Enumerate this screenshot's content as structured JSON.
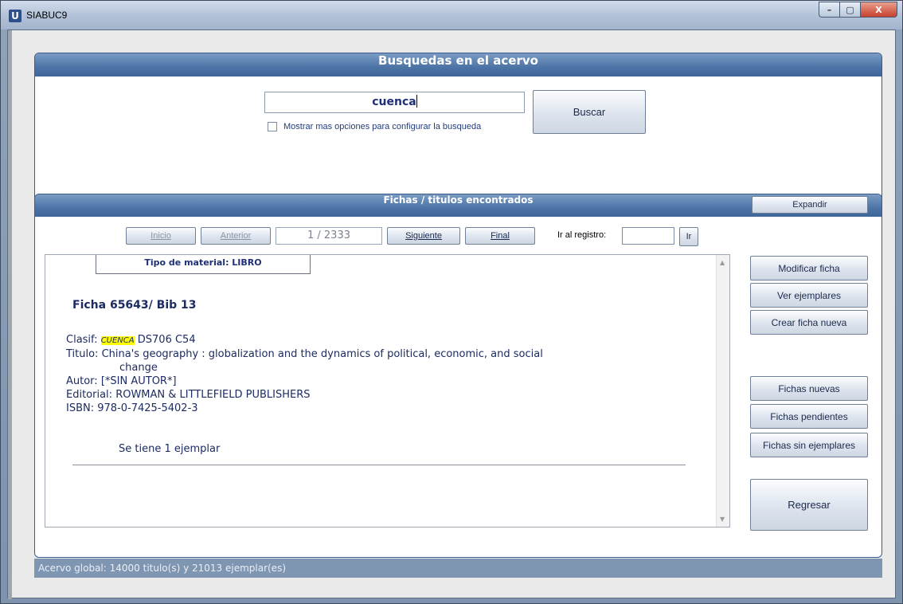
{
  "window": {
    "title": "SIABUC9",
    "icon_glyph": "U",
    "controls": {
      "minimize": "–",
      "maximize": "▢",
      "close": "X"
    }
  },
  "search": {
    "header": "Busquedas en el acervo",
    "query": "cuenca",
    "button": "Buscar",
    "checkbox_label": "Mostrar mas opciones para configurar la busqueda",
    "checkbox_checked": false
  },
  "results": {
    "header": "Fichas / titulos encontrados",
    "expand_button": "Expandir",
    "nav": {
      "first": "Inicio",
      "prev": "Anterior",
      "counter": "1 / 2333",
      "next": "Siguiente",
      "last": "Final",
      "goto_label": "Ir al registro:",
      "goto_value": "",
      "goto_button": "Ir"
    },
    "record": {
      "material_type": "Tipo de material: LIBRO",
      "ficha": "Ficha 65643/ Bib 13",
      "clasif_label": "Clasif:",
      "clasif_highlight": "CUENCA",
      "clasif_rest": "DS706 C54",
      "titulo_label": "Titulo:",
      "titulo_line1": "China's geography : globalization and the dynamics of political, economic, and social",
      "titulo_line2": "change",
      "autor_label": "Autor:",
      "autor": "[*SIN AUTOR*]",
      "editorial_label": "Editorial:",
      "editorial": "ROWMAN & LITTLEFIELD PUBLISHERS",
      "isbn_label": "ISBN:",
      "isbn": "978-0-7425-5402-3",
      "ejemplar_note": "Se tiene 1 ejemplar"
    },
    "actions": {
      "modificar": "Modificar ficha",
      "ver_ejemplares": "Ver ejemplares",
      "crear": "Crear ficha nueva",
      "nuevas": "Fichas nuevas",
      "pendientes": "Fichas pendientes",
      "sin_ejemplares": "Fichas sin ejemplares",
      "regresar": "Regresar"
    }
  },
  "status": "Acervo global: 14000 titulo(s) y 21013 ejemplar(es)"
}
